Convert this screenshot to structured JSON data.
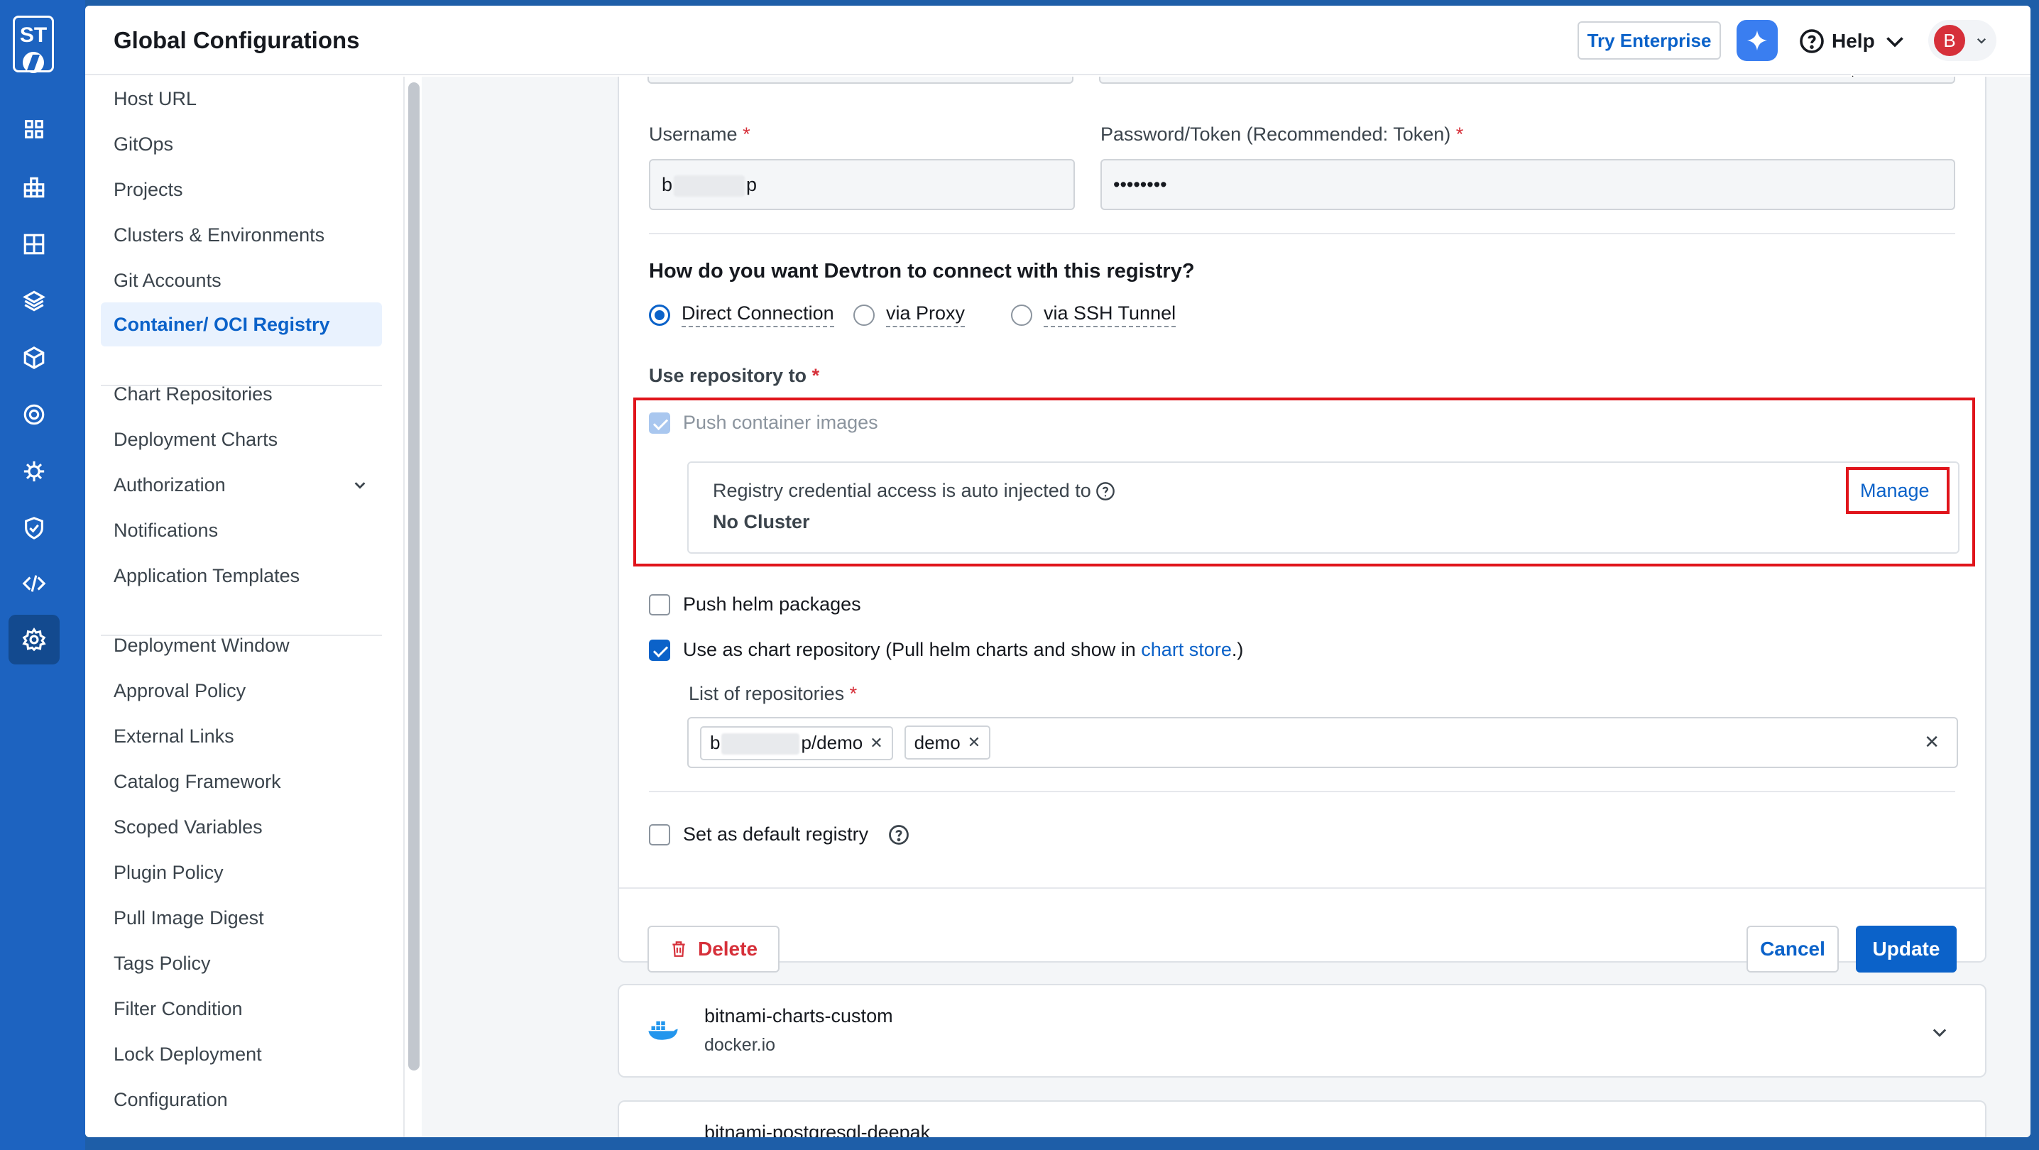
{
  "rail": {
    "logo_text": "ST",
    "icons": [
      "app-list-icon",
      "application-groups-icon",
      "chart-store-icon",
      "resource-browser-icon",
      "cube-icon",
      "security-icon",
      "global-configurations-icon"
    ]
  },
  "header": {
    "title": "Global Configurations",
    "try_enterprise": "Try Enterprise",
    "help": "Help",
    "avatar_initial": "B"
  },
  "sidebar": {
    "items": [
      {
        "label": "Host URL"
      },
      {
        "label": "GitOps"
      },
      {
        "label": "Projects"
      },
      {
        "label": "Clusters & Environments"
      },
      {
        "label": "Git Accounts"
      },
      {
        "label": "Container/ OCI Registry",
        "active": true
      },
      {
        "label": "Chart Repositories"
      },
      {
        "label": "Deployment Charts"
      },
      {
        "label": "Authorization"
      },
      {
        "label": "Notifications"
      },
      {
        "label": "Application Templates"
      },
      {
        "label": "Deployment Window"
      },
      {
        "label": "Approval Policy"
      },
      {
        "label": "External Links"
      },
      {
        "label": "Catalog Framework"
      },
      {
        "label": "Scoped Variables"
      },
      {
        "label": "Plugin Policy"
      },
      {
        "label": "Pull Image Digest"
      },
      {
        "label": "Tags Policy"
      },
      {
        "label": "Filter Condition"
      },
      {
        "label": "Lock Deployment"
      },
      {
        "label": "Configuration"
      }
    ]
  },
  "form": {
    "username_label": "Username",
    "username_prefix": "b",
    "username_suffix": "p",
    "password_label": "Password/Token (Recommended: Token)",
    "password_value": "••••••••",
    "connect_question": "How do you want Devtron to connect with this registry?",
    "connection_options": [
      "Direct Connection",
      "via Proxy",
      "via SSH Tunnel"
    ],
    "selected_connection": "Direct Connection",
    "use_repo_label": "Use repository to",
    "push_container": "Push container images",
    "credential_text": "Registry credential access is auto injected to",
    "credential_value": "No Cluster",
    "manage": "Manage",
    "push_helm": "Push helm packages",
    "chart_repo_text": "Use as chart repository (Pull helm charts and show in ",
    "chart_store_link": "chart store",
    "chart_repo_tail": ".)",
    "repo_list_label": "List of repositories",
    "repo_tag_1_prefix": "b",
    "repo_tag_1_suffix": "p/demo",
    "repo_tag_2": "demo",
    "default_registry": "Set as default registry",
    "delete": "Delete",
    "cancel": "Cancel",
    "update": "Update"
  },
  "registries": [
    {
      "name": "bitnami-charts-custom",
      "url": "docker.io"
    },
    {
      "name": "bitnami-postgresql-deepak"
    }
  ],
  "colors": {
    "accent": "#0b62c9",
    "rail": "#1d63c0",
    "danger": "#d6303a",
    "highlight": "#e0141b"
  }
}
